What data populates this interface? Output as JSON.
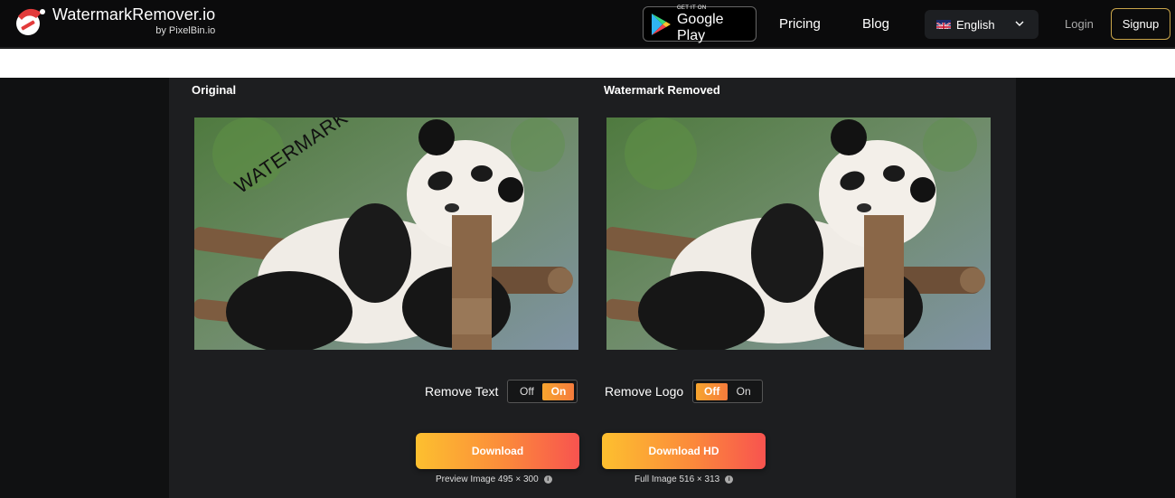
{
  "header": {
    "brand_title": "WatermarkRemover.io",
    "brand_sub": "by PixelBin.io",
    "gplay_small": "GET IT ON",
    "gplay_big": "Google Play",
    "nav": {
      "pricing": "Pricing",
      "blog": "Blog"
    },
    "language": "English",
    "login": "Login",
    "signup": "Signup"
  },
  "main": {
    "original_title": "Original",
    "removed_title": "Watermark Removed",
    "watermark_text": "WATERMARK",
    "remove_text": {
      "label": "Remove Text",
      "off": "Off",
      "on": "On",
      "selected": "On"
    },
    "remove_logo": {
      "label": "Remove Logo",
      "off": "Off",
      "on": "On",
      "selected": "Off"
    },
    "download": {
      "label": "Download",
      "note": "Preview Image 495 × 300"
    },
    "download_hd": {
      "label": "Download HD",
      "note": "Full Image 516 × 313"
    }
  },
  "colors": {
    "accent_start": "#fdc02f",
    "accent_end": "#f8534f",
    "signup_border": "#c9a54a"
  }
}
